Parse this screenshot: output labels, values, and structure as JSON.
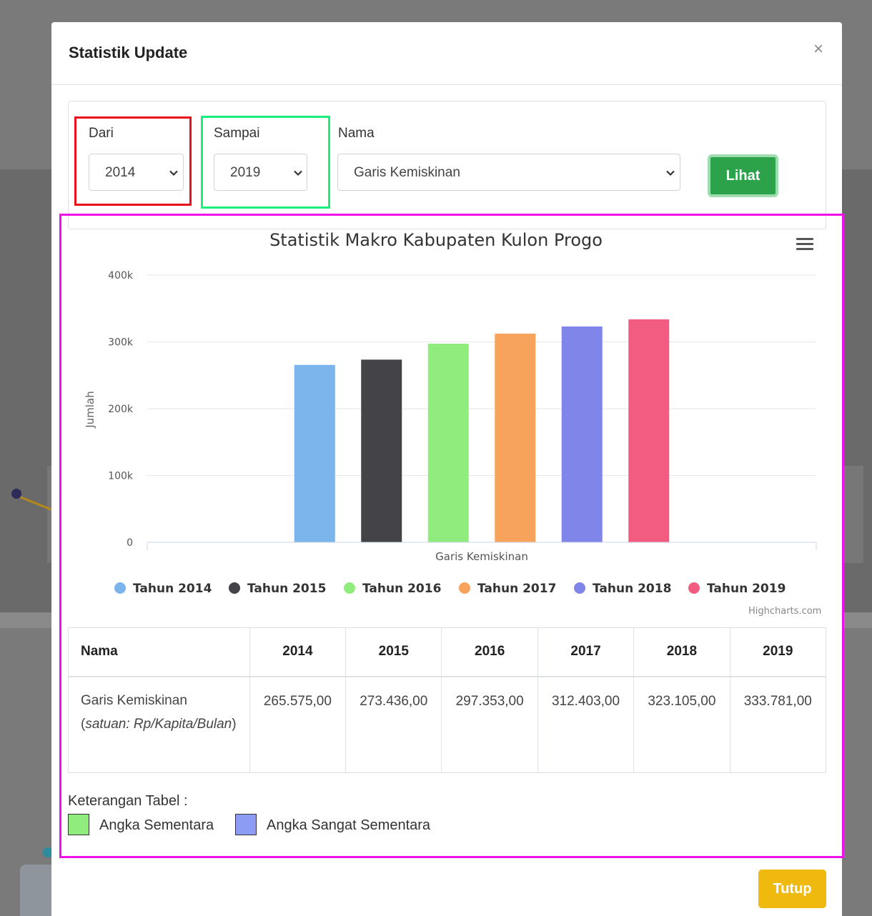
{
  "modal": {
    "title": "Statistik Update",
    "close_glyph": "×"
  },
  "filters": {
    "dari": {
      "label": "Dari",
      "value": "2014"
    },
    "sampai": {
      "label": "Sampai",
      "value": "2019"
    },
    "nama": {
      "label": "Nama",
      "value": "Garis Kemiskinan"
    },
    "submit_label": "Lihat"
  },
  "chart_data": {
    "type": "bar",
    "title": "Statistik Makro Kabupaten Kulon Progo",
    "xlabel": "",
    "ylabel": "Jumlah",
    "categories": [
      "Garis Kemiskinan"
    ],
    "ylim": [
      0,
      400000
    ],
    "yticks": [
      {
        "value": 0,
        "label": "0"
      },
      {
        "value": 100000,
        "label": "100k"
      },
      {
        "value": 200000,
        "label": "200k"
      },
      {
        "value": 300000,
        "label": "300k"
      },
      {
        "value": 400000,
        "label": "400k"
      }
    ],
    "grid": true,
    "legend_position": "bottom",
    "series": [
      {
        "name": "Tahun 2014",
        "values": [
          265575
        ],
        "color": "#7cb5ec"
      },
      {
        "name": "Tahun 2015",
        "values": [
          273436
        ],
        "color": "#434348"
      },
      {
        "name": "Tahun 2016",
        "values": [
          297353
        ],
        "color": "#90ed7d"
      },
      {
        "name": "Tahun 2017",
        "values": [
          312403
        ],
        "color": "#f7a35c"
      },
      {
        "name": "Tahun 2018",
        "values": [
          323105
        ],
        "color": "#8085e9"
      },
      {
        "name": "Tahun 2019",
        "values": [
          333781
        ],
        "color": "#f15c80"
      }
    ],
    "credits": "Highcharts.com"
  },
  "table": {
    "headers": [
      "Nama",
      "2014",
      "2015",
      "2016",
      "2017",
      "2018",
      "2019"
    ],
    "row": {
      "name": "Garis Kemiskinan",
      "unit_open": "(",
      "unit": "satuan: Rp/Kapita/Bulan",
      "unit_close": ")",
      "values": [
        "265.575,00",
        "273.436,00",
        "297.353,00",
        "312.403,00",
        "323.105,00",
        "333.781,00"
      ]
    }
  },
  "keterangan": {
    "label": "Keterangan Tabel :",
    "items": [
      {
        "text": "Angka Sementara",
        "color": "#90ed7d"
      },
      {
        "text": "Angka Sangat Sementara",
        "color": "#8c9cf5"
      }
    ]
  },
  "footer": {
    "close_label": "Tutup"
  }
}
